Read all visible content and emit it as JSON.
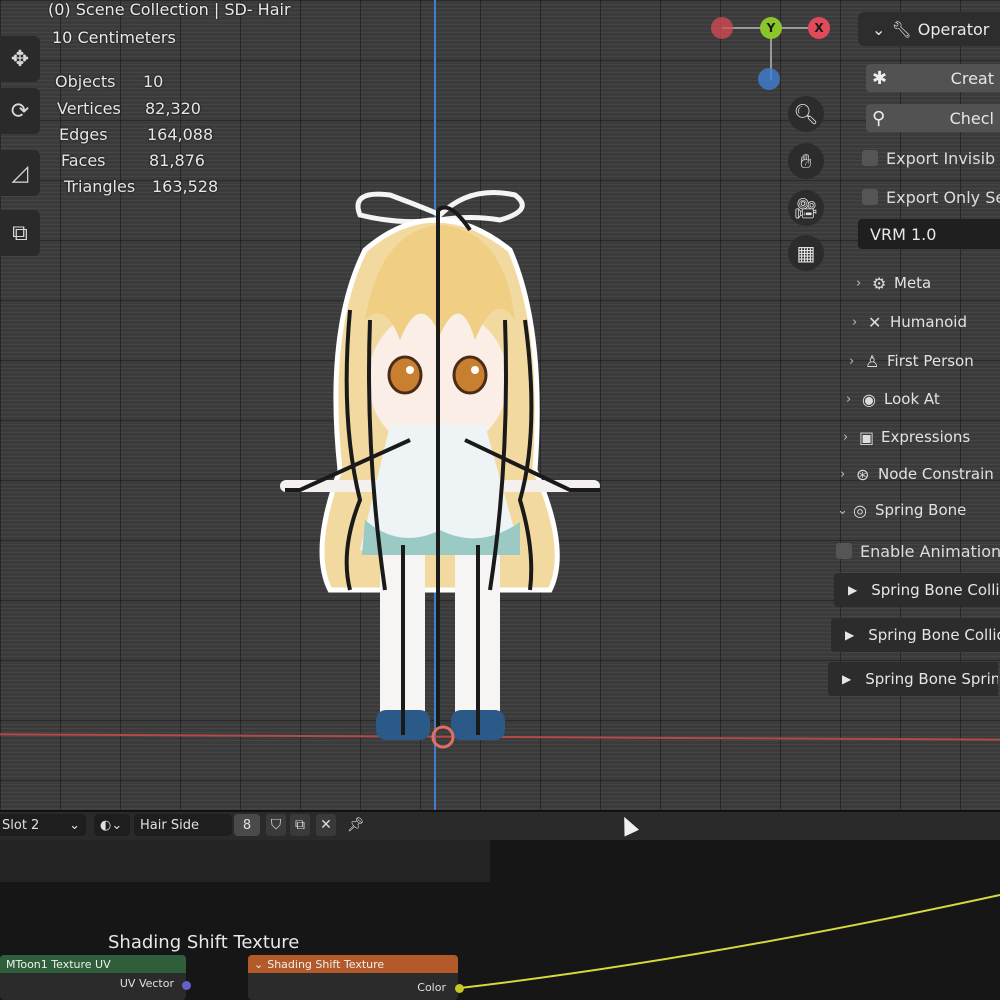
{
  "viewport": {
    "collection_title": "(0) Scene Collection | SD- Hair",
    "unit_scale": "10 Centimeters",
    "stats": [
      {
        "label": "Objects",
        "value": "10"
      },
      {
        "label": "Vertices",
        "value": "82,320"
      },
      {
        "label": "Edges",
        "value": "164,088"
      },
      {
        "label": "Faces",
        "value": "81,876"
      },
      {
        "label": "Triangles",
        "value": "163,528"
      }
    ],
    "gizmo": {
      "y_label": "Y",
      "x_label": "X"
    },
    "axis_colors": {
      "x": "#e04a5a",
      "y": "#8ac52b",
      "z": "#4a8fd8"
    },
    "toolbar_icons": [
      "move-icon",
      "rotate-icon",
      "scale-icon",
      "measure-icon",
      "transform-icon"
    ],
    "nav_icons": [
      "zoom-icon",
      "pan-hand-icon",
      "camera-icon",
      "grid-icon"
    ]
  },
  "sidebar": {
    "operator_label": "Operator",
    "create_label": "Creat",
    "check_label": "Checl",
    "export_invisible_label": "Export Invisib",
    "export_selected_label": "Export Only Se",
    "vrm_version": "VRM 1.0",
    "sections": [
      {
        "label": "Meta",
        "icon": "meta-icon",
        "expanded": false
      },
      {
        "label": "Humanoid",
        "icon": "humanoid-icon",
        "expanded": false
      },
      {
        "label": "First Person",
        "icon": "first-person-icon",
        "expanded": false
      },
      {
        "label": "Look At",
        "icon": "eye-icon",
        "expanded": false
      },
      {
        "label": "Expressions",
        "icon": "expressions-icon",
        "expanded": false
      },
      {
        "label": "Node Constrain",
        "icon": "constraint-icon",
        "expanded": false
      },
      {
        "label": "Spring Bone",
        "icon": "spring-bone-icon",
        "expanded": true
      }
    ],
    "enable_animation_label": "Enable Animation",
    "spring_subpanels": [
      "Spring Bone Colli",
      "Spring Bone Collic",
      "Spring Bone Spring"
    ]
  },
  "node_header": {
    "slot_label": "Slot 2",
    "material_name": "Hair Side",
    "user_count": "8"
  },
  "node_editor": {
    "frame_label": "Shading Shift Texture",
    "nodes": [
      {
        "title": "MToon1 Texture UV",
        "output": "UV Vector",
        "head_color": "#2e5e3a"
      },
      {
        "title": "Shading Shift Texture",
        "output": "Color",
        "head_color": "#b45a2a"
      }
    ],
    "link_color": "#d8d840"
  }
}
